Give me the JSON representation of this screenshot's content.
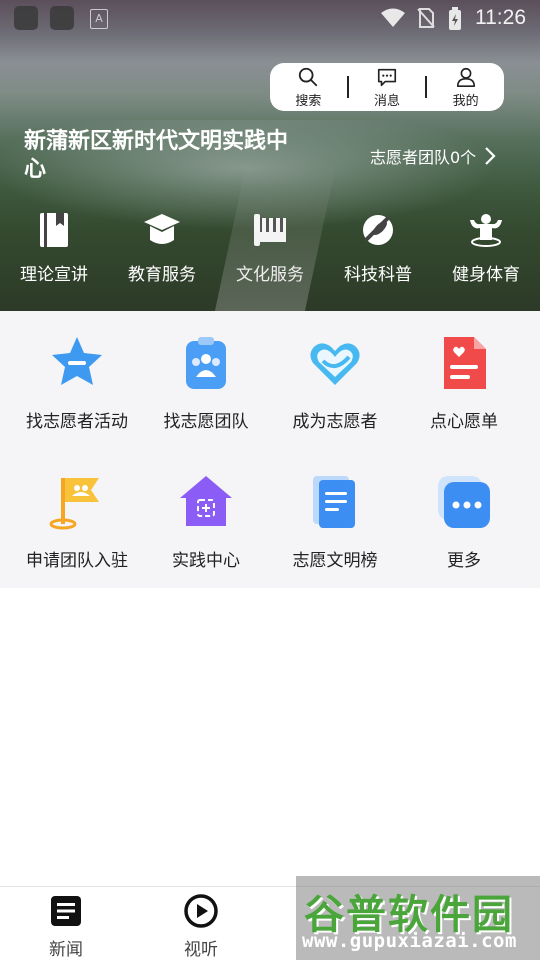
{
  "status_bar": {
    "time": "11:26",
    "icons": [
      "wifi-icon",
      "no-sim-icon",
      "battery-icon"
    ]
  },
  "top_bar": {
    "search": "搜索",
    "messages": "消息",
    "mine": "我的"
  },
  "center": {
    "title": "新蒲新区新时代文明实践中心",
    "team_count": "志愿者团队0个"
  },
  "categories": [
    {
      "label": "理论宣讲",
      "icon": "book-icon"
    },
    {
      "label": "教育服务",
      "icon": "graduation-cap-icon"
    },
    {
      "label": "文化服务",
      "icon": "piano-icon"
    },
    {
      "label": "科技科普",
      "icon": "rocket-icon"
    },
    {
      "label": "健身体育",
      "icon": "muscle-icon"
    }
  ],
  "services": [
    {
      "label": "找志愿者活动",
      "icon": "star-chat-icon"
    },
    {
      "label": "找志愿团队",
      "icon": "team-clipboard-icon"
    },
    {
      "label": "成为志愿者",
      "icon": "heart-icon"
    },
    {
      "label": "点心愿单",
      "icon": "wish-list-icon"
    },
    {
      "label": "申请团队入驻",
      "icon": "flag-icon"
    },
    {
      "label": "实践中心",
      "icon": "house-icon"
    },
    {
      "label": "志愿文明榜",
      "icon": "document-icon"
    },
    {
      "label": "更多",
      "icon": "more-icon"
    }
  ],
  "bottom_nav": [
    {
      "label": "新闻",
      "icon": "news-icon"
    },
    {
      "label": "视听",
      "icon": "play-icon"
    }
  ],
  "watermark": {
    "title": "谷普软件园",
    "url": "www.gupuxiazai.com"
  },
  "colors": {
    "hero_dark": "#2c3a27",
    "grid_bg": "#f5f5f7",
    "accent_blue": "#3d8ef2",
    "accent_red": "#f04a4a",
    "accent_purple": "#8b5cf6",
    "watermark_green": "#4aa53a"
  }
}
